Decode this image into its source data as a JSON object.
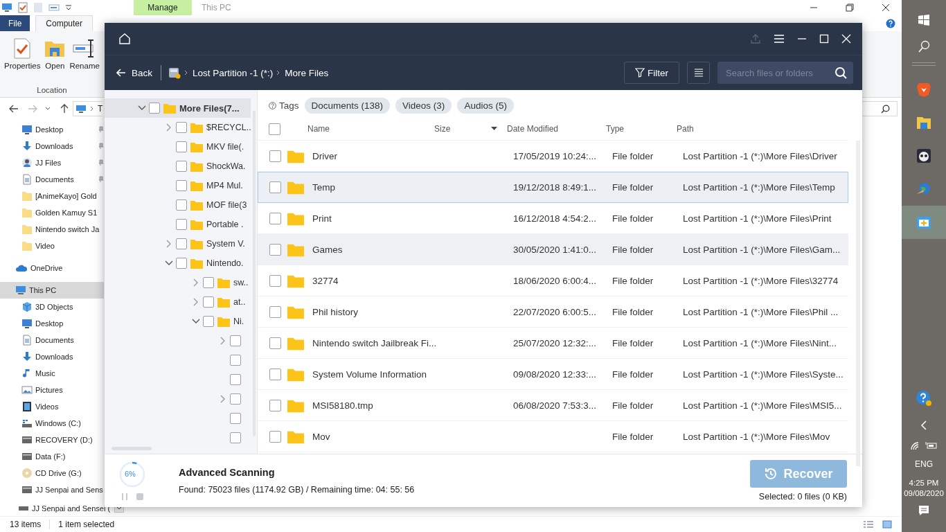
{
  "explorer": {
    "title": "This PC",
    "context_tab": "Manage",
    "ribbon_tabs": [
      {
        "label": "File",
        "kind": "file",
        "selected": false
      },
      {
        "label": "Computer",
        "kind": "tab",
        "selected": true
      }
    ],
    "ribbon_buttons": [
      {
        "label": "Properties",
        "kind": "properties"
      },
      {
        "label": "Open",
        "kind": "open"
      },
      {
        "label": "Rename",
        "kind": "rename"
      }
    ],
    "ribbon_group": "Location",
    "address": "T",
    "quick_access": [
      {
        "label": "Desktop",
        "kind": "desktop",
        "pinned": true,
        "selected": false
      },
      {
        "label": "Downloads",
        "kind": "download",
        "pinned": true,
        "selected": false
      },
      {
        "label": "JJ Files",
        "kind": "user",
        "pinned": true,
        "selected": false
      },
      {
        "label": "Documents",
        "kind": "doc",
        "pinned": true,
        "selected": false
      },
      {
        "label": "[AnimeKayo] Gold",
        "kind": "folder",
        "pinned": false,
        "selected": false
      },
      {
        "label": "Golden Kamuy S1",
        "kind": "folder",
        "pinned": false,
        "selected": false
      },
      {
        "label": "Nintendo switch Ja",
        "kind": "folder",
        "pinned": false,
        "selected": false
      },
      {
        "label": "Video",
        "kind": "folder",
        "pinned": false,
        "selected": false
      }
    ],
    "onedrive": {
      "label": "OneDrive",
      "selected": false
    },
    "this_pc": {
      "label": "This PC",
      "selected": true,
      "children": [
        {
          "label": "3D Objects",
          "kind": "cube",
          "selected": false
        },
        {
          "label": "Desktop",
          "kind": "desktop",
          "selected": false
        },
        {
          "label": "Documents",
          "kind": "doc",
          "selected": false
        },
        {
          "label": "Downloads",
          "kind": "download",
          "selected": false
        },
        {
          "label": "Music",
          "kind": "music",
          "selected": false
        },
        {
          "label": "Pictures",
          "kind": "pictures",
          "selected": false
        },
        {
          "label": "Videos",
          "kind": "video",
          "selected": false
        },
        {
          "label": "Windows (C:)",
          "kind": "windrive",
          "selected": false
        },
        {
          "label": "RECOVERY (D:)",
          "kind": "drive",
          "selected": false
        },
        {
          "label": "Data (F:)",
          "kind": "drive",
          "selected": false
        },
        {
          "label": "CD Drive (G:)",
          "kind": "cd",
          "selected": false
        },
        {
          "label": "JJ Senpai and Sens",
          "kind": "drive",
          "selected": false
        }
      ]
    },
    "bottom_item": "JJ Senpai and Sensei (",
    "status": {
      "items": "13 items",
      "selection": "1 item selected"
    }
  },
  "recovery": {
    "back": "Back",
    "breadcrumb": [
      "Lost Partition -1 (*:)",
      "More Files"
    ],
    "filter": "Filter",
    "search_placeholder": "Search files or folders",
    "tree": [
      {
        "label": "More Files(7...",
        "checked": false,
        "expanded": true,
        "selected": true,
        "children": [
          {
            "label": "$RECYCL..",
            "checked": false,
            "expanded": false,
            "selected": false
          },
          {
            "label": "MKV file(.",
            "checked": false,
            "selected": false
          },
          {
            "label": "ShockWa.",
            "checked": false,
            "selected": false
          },
          {
            "label": "MP4 Mul.",
            "checked": false,
            "selected": false
          },
          {
            "label": "MOF file(3",
            "checked": false,
            "selected": false
          },
          {
            "label": "Portable .",
            "checked": false,
            "selected": false
          },
          {
            "label": "System V.",
            "checked": false,
            "expanded": false,
            "selected": false
          },
          {
            "label": "Nintendo.",
            "checked": false,
            "expanded": true,
            "selected": false,
            "children": [
              {
                "label": "sw..",
                "checked": false,
                "expanded": false,
                "selected": false
              },
              {
                "label": "at..",
                "checked": false,
                "expanded": false,
                "selected": false
              },
              {
                "label": "Ni.",
                "checked": false,
                "expanded": true,
                "selected": false,
                "children": [
                  {
                    "checked": false,
                    "expanded": false,
                    "selected": false
                  },
                  {
                    "checked": false,
                    "selected": false
                  },
                  {
                    "checked": false,
                    "selected": false
                  },
                  {
                    "checked": false,
                    "expanded": false,
                    "selected": false
                  },
                  {
                    "checked": false,
                    "selected": false
                  },
                  {
                    "checked": false,
                    "selected": false
                  }
                ]
              }
            ]
          }
        ]
      }
    ],
    "tags_label": "Tags",
    "tags": [
      {
        "label": "Documents (138)",
        "selected": false
      },
      {
        "label": "Videos (3)",
        "selected": false
      },
      {
        "label": "Audios (5)",
        "selected": false
      }
    ],
    "select_all": {
      "checked": false
    },
    "columns": [
      {
        "label": "Name",
        "sorted": false
      },
      {
        "label": "Size",
        "sorted": true
      },
      {
        "label": "Date Modified",
        "sorted": false
      },
      {
        "label": "Type",
        "sorted": false
      },
      {
        "label": "Path",
        "sorted": false
      }
    ],
    "rows": [
      {
        "name": "Driver",
        "date": "17/05/2019 10:24:...",
        "type": "File folder",
        "path": "Lost Partition -1 (*:)\\More Files\\Driver",
        "checked": false,
        "selected": false,
        "hovered": false
      },
      {
        "name": "Temp",
        "date": "19/12/2018 8:49:1...",
        "type": "File folder",
        "path": "Lost Partition -1 (*:)\\More Files\\Temp",
        "checked": false,
        "selected": true,
        "hovered": false
      },
      {
        "name": "Print",
        "date": "16/12/2018 4:54:2...",
        "type": "File folder",
        "path": "Lost Partition -1 (*:)\\More Files\\Print",
        "checked": false,
        "selected": false,
        "hovered": false
      },
      {
        "name": "Games",
        "date": "30/05/2020 1:41:0...",
        "type": "File folder",
        "path": "Lost Partition -1 (*:)\\More Files\\Gam...",
        "checked": false,
        "selected": false,
        "hovered": true
      },
      {
        "name": "32774",
        "date": "18/06/2020 6:00:4...",
        "type": "File folder",
        "path": "Lost Partition -1 (*:)\\More Files\\32774",
        "checked": false,
        "selected": false,
        "hovered": false
      },
      {
        "name": "Phil history",
        "date": "22/07/2020 6:00:5...",
        "type": "File folder",
        "path": "Lost Partition -1 (*:)\\More Files\\Phil ...",
        "checked": false,
        "selected": false,
        "hovered": false
      },
      {
        "name": "Nintendo switch Jailbreak Fi...",
        "date": "25/07/2020 12:32:...",
        "type": "File folder",
        "path": "Lost Partition -1 (*:)\\More Files\\Nint...",
        "checked": false,
        "selected": false,
        "hovered": false
      },
      {
        "name": "System Volume Information",
        "date": "09/08/2020 12:33:...",
        "type": "File folder",
        "path": "Lost Partition -1 (*:)\\More Files\\Syste...",
        "checked": false,
        "selected": false,
        "hovered": false
      },
      {
        "name": "MSI58180.tmp",
        "date": "06/08/2020 7:53:3...",
        "type": "File folder",
        "path": "Lost Partition -1 (*:)\\More Files\\MSI5...",
        "checked": false,
        "selected": false,
        "hovered": false
      },
      {
        "name": "Mov",
        "type": "File folder",
        "path": "Lost Partition -1 (*:)\\More Files\\Mov",
        "checked": false,
        "selected": false,
        "hovered": false
      }
    ],
    "scan": {
      "level": 0.06,
      "percent": "6%",
      "title": "Advanced Scanning",
      "found": "Found: 75023 files (1174.92 GB) / Remaining time: 04: 55: 56"
    },
    "recover": {
      "label": "Recover",
      "disabled": true
    },
    "selected_info": "Selected: 0 files (0 KB)"
  },
  "taskbar": {
    "apps": [
      {
        "kind": "brave",
        "selected": false
      },
      {
        "kind": "explorer",
        "selected": false
      },
      {
        "kind": "panda",
        "selected": false
      },
      {
        "kind": "globe",
        "selected": false
      },
      {
        "kind": "toolbox",
        "selected": true
      }
    ],
    "language": "ENG",
    "time": "4:25 PM",
    "date": "09/08/2020"
  }
}
